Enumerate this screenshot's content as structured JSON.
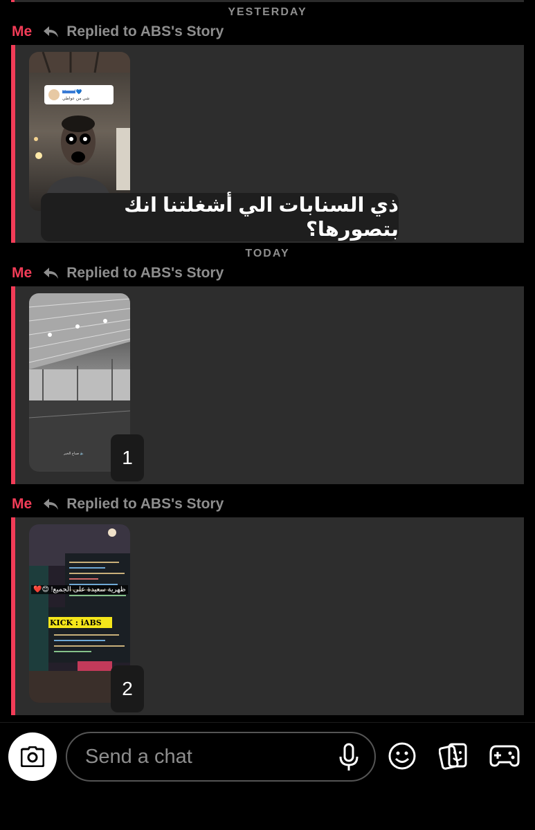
{
  "separators": {
    "yesterday": "YESTERDAY",
    "today": "TODAY"
  },
  "messages": [
    {
      "sender": "Me",
      "reply_label": "Replied to ABS's Story",
      "caption": "ذي السنابات الي أشغلتنا انك بتصورها؟",
      "overlay_name": "Hamd💙",
      "overlay_sub": "شي من عواطي",
      "counter": ""
    },
    {
      "sender": "Me",
      "reply_label": "Replied to ABS's Story",
      "caption": "",
      "overlay_small": "🔈 صباح الخير",
      "counter": "1"
    },
    {
      "sender": "Me",
      "reply_label": "Replied to ABS's Story",
      "caption": "",
      "story_text": "ظهرية سعيدة على الجميع! 😊❤️",
      "story_tag": "KICK : iABS",
      "counter": "2"
    }
  ],
  "composer": {
    "placeholder": "Send a chat",
    "icons": [
      "camera-icon",
      "microphone-icon",
      "emoji-icon",
      "stickers-icon",
      "games-icon"
    ]
  },
  "colors": {
    "accent": "#f23c57",
    "bubble": "#2d2d2d",
    "muted": "#8e8e8e"
  }
}
